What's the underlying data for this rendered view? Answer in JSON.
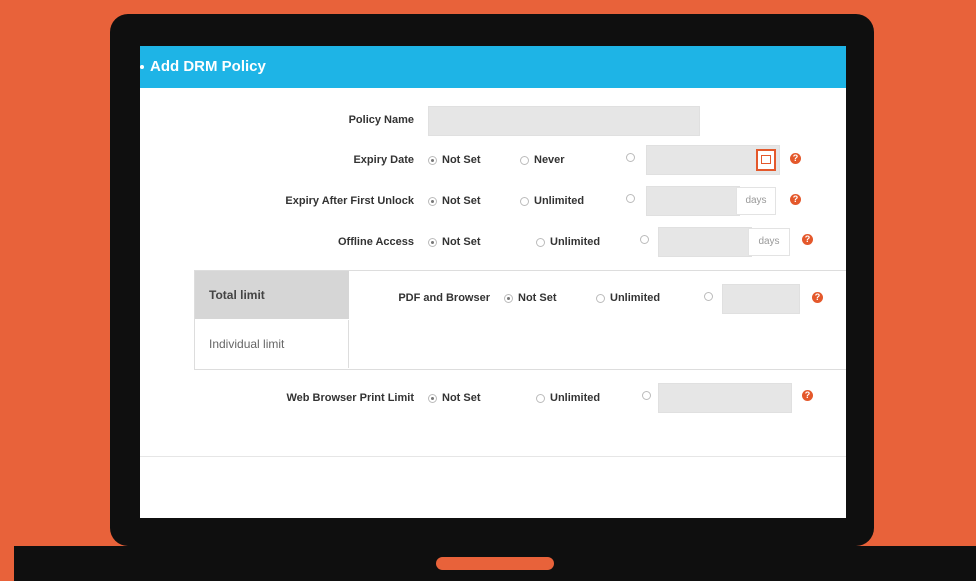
{
  "dialog": {
    "title": "Add DRM Policy"
  },
  "fields": {
    "policy_name": {
      "label": "Policy Name",
      "value": ""
    },
    "expiry_date": {
      "label": "Expiry Date",
      "opt1": "Not Set",
      "opt2": "Never"
    },
    "expiry_after_unlock": {
      "label": "Expiry After First Unlock",
      "opt1": "Not Set",
      "opt2": "Unlimited",
      "unit": "days"
    },
    "offline_access": {
      "label": "Offline Access",
      "opt1": "Not Set",
      "opt2": "Unlimited",
      "unit": "days"
    },
    "pdf_browser": {
      "label": "PDF and Browser",
      "opt1": "Not Set",
      "opt2": "Unlimited"
    },
    "web_print_limit": {
      "label": "Web Browser Print Limit",
      "opt1": "Not Set",
      "opt2": "Unlimited"
    }
  },
  "tabs": {
    "total": "Total limit",
    "individual": "Individual limit"
  },
  "help": "?",
  "colors": {
    "background": "#e8623a",
    "titlebar": "#1eb4e6",
    "accent": "#e4582b"
  },
  "icons": [
    "calendar-icon",
    "help-icon"
  ]
}
